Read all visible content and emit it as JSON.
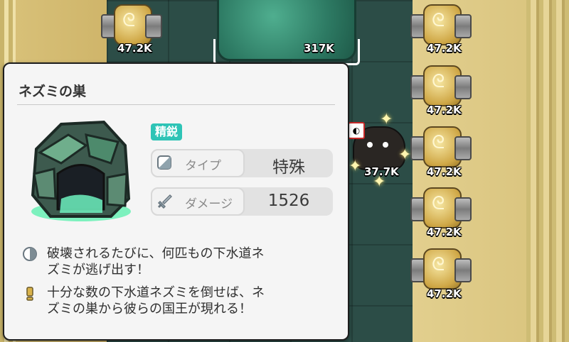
{
  "enemy_card": {
    "name": "ネズミの巣",
    "rank_badge": "精鋭",
    "stats": [
      {
        "icon": "type-icon",
        "label": "タイプ",
        "value": "特殊"
      },
      {
        "icon": "sword-icon",
        "label": "ダメージ",
        "value": "1526"
      }
    ],
    "descriptions": [
      {
        "icon": "half-circle-icon",
        "text_line1": "破壊されるたびに、何匹もの下水道ネ",
        "text_line2": "ズミが逃げ出す！"
      },
      {
        "icon": "exclamation-icon",
        "text_line1": "十分な数の下水道ネズミを倒せば、ネ",
        "text_line2": "ズミの巣から彼らの国王が現れる！"
      }
    ]
  },
  "field": {
    "boss_hp": "317K",
    "rat_hp": "37.7K",
    "towers_left": [
      {
        "hp": "47.2K"
      }
    ],
    "towers_right": [
      {
        "hp": "47.2K"
      },
      {
        "hp": "47.2K"
      },
      {
        "hp": "47.2K"
      },
      {
        "hp": "47.2K"
      },
      {
        "hp": "47.2K"
      }
    ]
  },
  "colors": {
    "rank_badge": "#2ec4b6",
    "card_bg": "#f5f5f5",
    "floor": "#2c4d47"
  }
}
